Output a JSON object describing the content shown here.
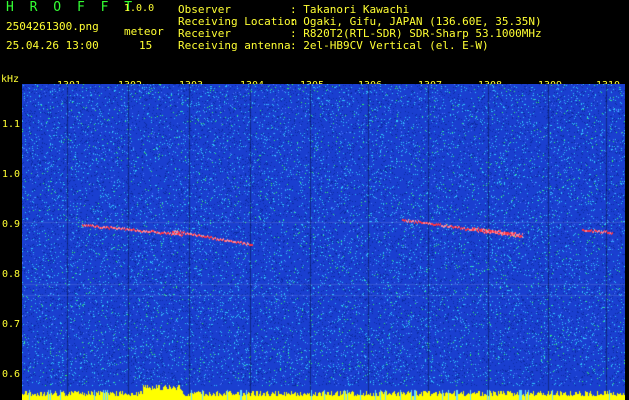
{
  "header": {
    "app_title": "H R O F F T",
    "version": "1.0.0",
    "filename": "2504261300.png",
    "datetime": "25.04.26 13:00",
    "meteor_label": "meteor",
    "meteor_count": "15",
    "info": [
      {
        "label": "Observer",
        "value": ": Takanori Kawachi"
      },
      {
        "label": "Receiving Location",
        "value": ": Ogaki, Gifu, JAPAN (136.60E, 35.35N)"
      },
      {
        "label": "Receiver",
        "value": ": R820T2(RTL-SDR) SDR-Sharp 53.1000MHz"
      },
      {
        "label": "Receiving antenna",
        "value": ": 2el-HB9CV Vertical (el. E-W)"
      }
    ]
  },
  "plot": {
    "unit": "kHz",
    "y_ticks": [
      "1.1",
      "1.0",
      "0.9",
      "0.8",
      "0.7",
      "0.6"
    ],
    "x_ticks": [
      "1301",
      "1302",
      "1303",
      "1304",
      "1305",
      "1306",
      "1307",
      "1308",
      "1309",
      "1310"
    ],
    "colors": {
      "background": "#1a3fd0",
      "noise_cyan": "#33ccff",
      "noise_green": "#33ff66",
      "signal": "#ff3344",
      "baseline": "#ffff00"
    }
  }
}
